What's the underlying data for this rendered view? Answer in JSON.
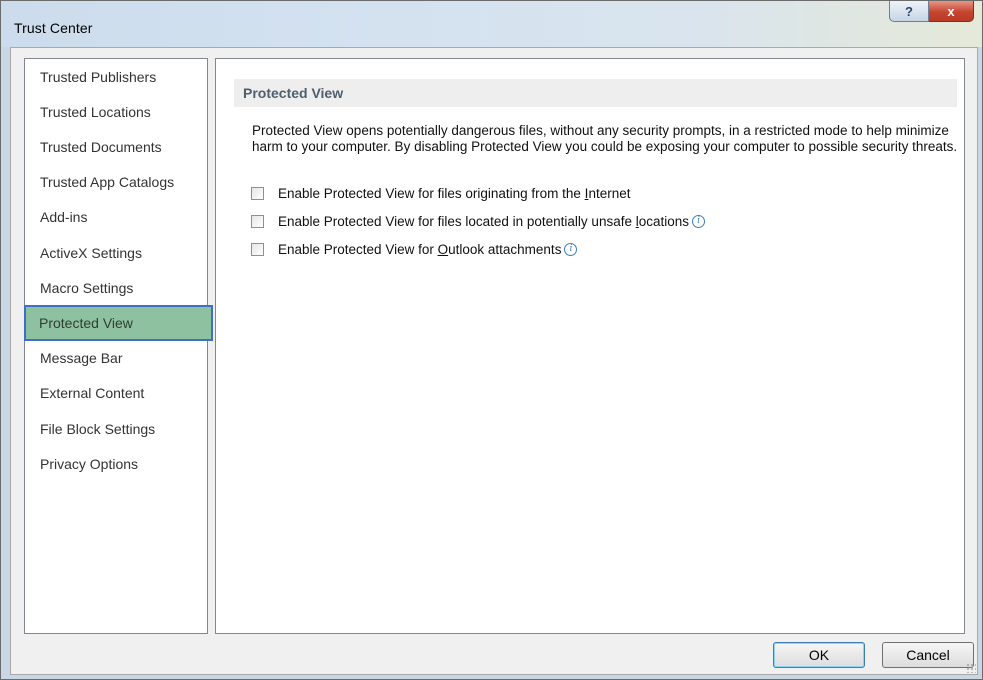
{
  "window": {
    "title": "Trust Center",
    "help_glyph": "?",
    "close_glyph": "x"
  },
  "nav": {
    "items": [
      {
        "label": "Trusted Publishers"
      },
      {
        "label": "Trusted Locations"
      },
      {
        "label": "Trusted Documents"
      },
      {
        "label": "Trusted App Catalogs"
      },
      {
        "label": "Add-ins"
      },
      {
        "label": "ActiveX Settings"
      },
      {
        "label": "Macro Settings"
      },
      {
        "label": "Protected View",
        "selected": true
      },
      {
        "label": "Message Bar"
      },
      {
        "label": "External Content"
      },
      {
        "label": "File Block Settings"
      },
      {
        "label": "Privacy Options"
      }
    ]
  },
  "panel": {
    "header": "Protected View",
    "description": "Protected View opens potentially dangerous files, without any security prompts, in a restricted mode to help minimize harm to your computer. By disabling Protected View you could be exposing your computer to possible security threats.",
    "options": [
      {
        "pre": "Enable Protected View for files originating from the ",
        "key": "I",
        "post": "nternet",
        "checked": false,
        "info": false
      },
      {
        "pre": "Enable Protected View for files located in potentially unsafe ",
        "key": "l",
        "post": "ocations",
        "checked": false,
        "info": true
      },
      {
        "pre": "Enable Protected View for ",
        "key": "O",
        "post": "utlook attachments",
        "checked": false,
        "info": true
      }
    ],
    "info_glyph": "i"
  },
  "footer": {
    "ok_label": "OK",
    "cancel_label": "Cancel"
  },
  "colors": {
    "selected_bg": "#8dc19f",
    "selected_outline": "#3d6fc6",
    "close_red": "#c64530"
  }
}
